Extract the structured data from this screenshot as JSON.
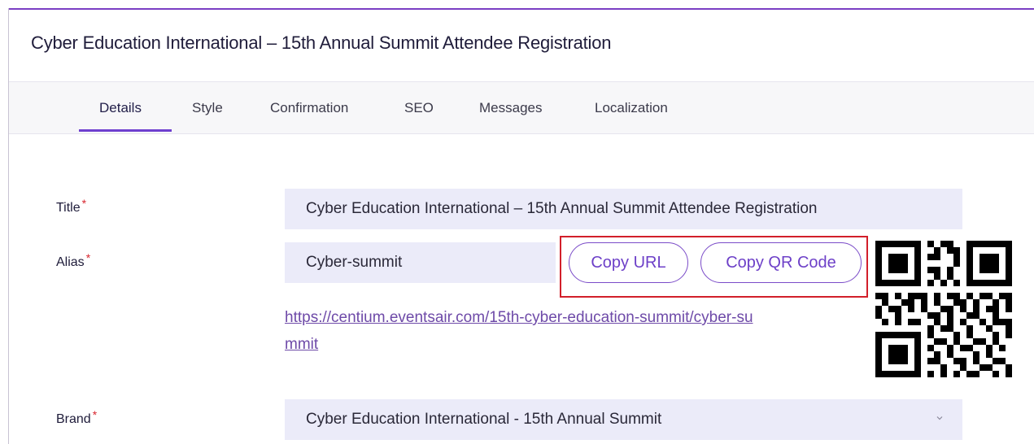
{
  "page": {
    "title": "Cyber Education International – 15th Annual Summit Attendee Registration"
  },
  "tabs": [
    {
      "label": "Details",
      "active": true
    },
    {
      "label": "Style",
      "active": false
    },
    {
      "label": "Confirmation",
      "active": false
    },
    {
      "label": "SEO",
      "active": false
    },
    {
      "label": "Messages",
      "active": false
    },
    {
      "label": "Localization",
      "active": false
    }
  ],
  "form": {
    "title": {
      "label": "Title",
      "required_mark": "*",
      "value": "Cyber Education International – 15th Annual Summit Attendee Registration"
    },
    "alias": {
      "label": "Alias",
      "required_mark": "*",
      "value": "Cyber-summit"
    },
    "url": {
      "line1": "https://centium.eventsair.com/15th-cyber-education-summit/cyber-su",
      "line2": "mmit"
    },
    "copy_url_label": "Copy URL",
    "copy_qr_label": "Copy QR Code",
    "brand": {
      "label": "Brand",
      "required_mark": "*",
      "value": "Cyber Education International - 15th Annual Summit"
    }
  },
  "icons": {
    "qr": "qr-code-icon",
    "chevron": "chevron-down-icon"
  },
  "colors": {
    "accent": "#6e3fcf",
    "field_bg": "#ebebf9",
    "required": "#d8262f",
    "highlight": "#d21f2a"
  }
}
